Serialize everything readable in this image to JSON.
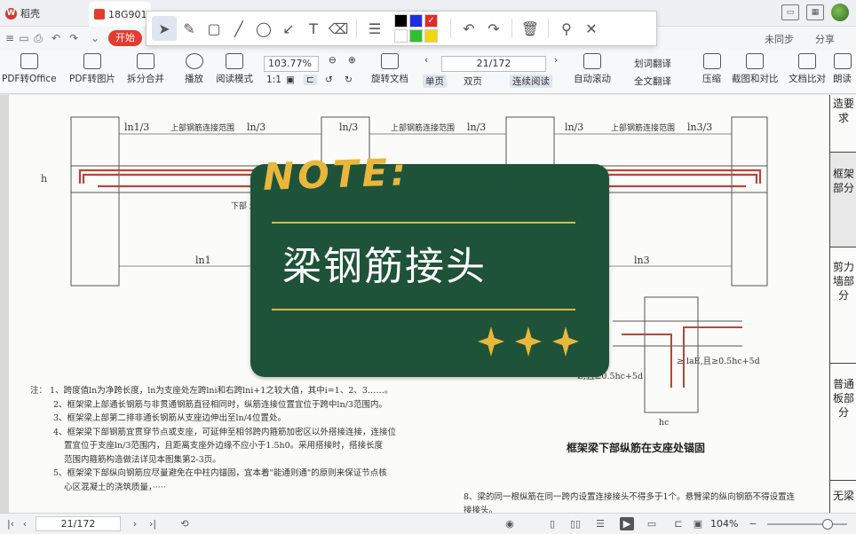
{
  "tabs": {
    "app_label": "稻壳",
    "doc_label": "18G901"
  },
  "quick": {
    "start_label": "开始",
    "sync_label": "未同步",
    "share_label": "分享"
  },
  "ribbon": {
    "pdf_to_office": "PDF转Office",
    "pdf_to_image": "PDF转图片",
    "split_merge": "拆分合并",
    "play": "播放",
    "read_mode": "阅读模式",
    "zoom": "103.77%",
    "page": "21/172",
    "rotate_doc": "旋转文档",
    "single_page": "单页",
    "double_page": "双页",
    "continuous": "连续阅读",
    "auto_scroll": "自动滚动",
    "word_translate": "划词翻译",
    "full_translate": "全文翻译",
    "compress": "压缩",
    "screenshot_compare": "截图和对比",
    "doc_compare": "文档比对",
    "read_aloud": "朗读"
  },
  "annotation_toolbar": {
    "colors": [
      "#000000",
      "#1c2fe0",
      "#e02b2b",
      "#ffffff",
      "#2fc12f",
      "#f5d40a"
    ]
  },
  "sidebar_tabs": [
    "造要求",
    "框架部分",
    "剪力墙部分",
    "普通板部分",
    "无梁"
  ],
  "drawing": {
    "label_top_splice": "上部钢筋连接范围",
    "label_ln1_3": "ln1/3",
    "label_ln_3": "ln/3",
    "label_ln3_3": "ln3/3",
    "label_ln1": "ln1",
    "label_ln3": "ln3",
    "label_h": "h",
    "label_hc": "hc",
    "label_anchor_right": "≥ laE,且≥0.5hc+5d",
    "label_anchor_left": "E,且≥0.5hc+5d",
    "label_lower_splice": "下部\n连接",
    "caption": "框架梁下部纵筋在支座处锚固"
  },
  "notes": [
    "注：  1、跨度值ln为净跨长度，ln为支座处左跨lni和右跨lni+1之较大值，其中i=1、2、3……。",
    "2、框架梁上部通长钢筋与非贯通钢筋直径相同时，纵筋连接位置宜位于跨中ln/3范围内。",
    "3、框架梁上部第二排非通长钢筋从支座边伸出至ln/4位置处。",
    "4、框架梁下部钢筋宜贯穿节点或支座，可延伸至相邻跨内箍筋加密区以外搭接连接，连接位",
    "置宜位于支座ln/3范围内，且距离支座外边缘不应小于1.5h0。采用搭接时，搭接长度",
    "范围内箍筋构造做法详见本图集第2-3页。",
    "5、框架梁下部纵向钢筋应尽量避免在中柱内锚固，宜本着\"能通则通\"的原则来保证节点核",
    "心区混凝土的浇筑质量，·····"
  ],
  "notes_right": "8、梁的同一根纵筋在同一跨内设置连接接头不得多于1个。悬臂梁的纵向钢筋不得设置连接接头。",
  "note_card": {
    "title": "NOTE:",
    "main_text": "梁钢筋接头"
  },
  "status": {
    "page": "21/172",
    "zoom": "104%"
  }
}
